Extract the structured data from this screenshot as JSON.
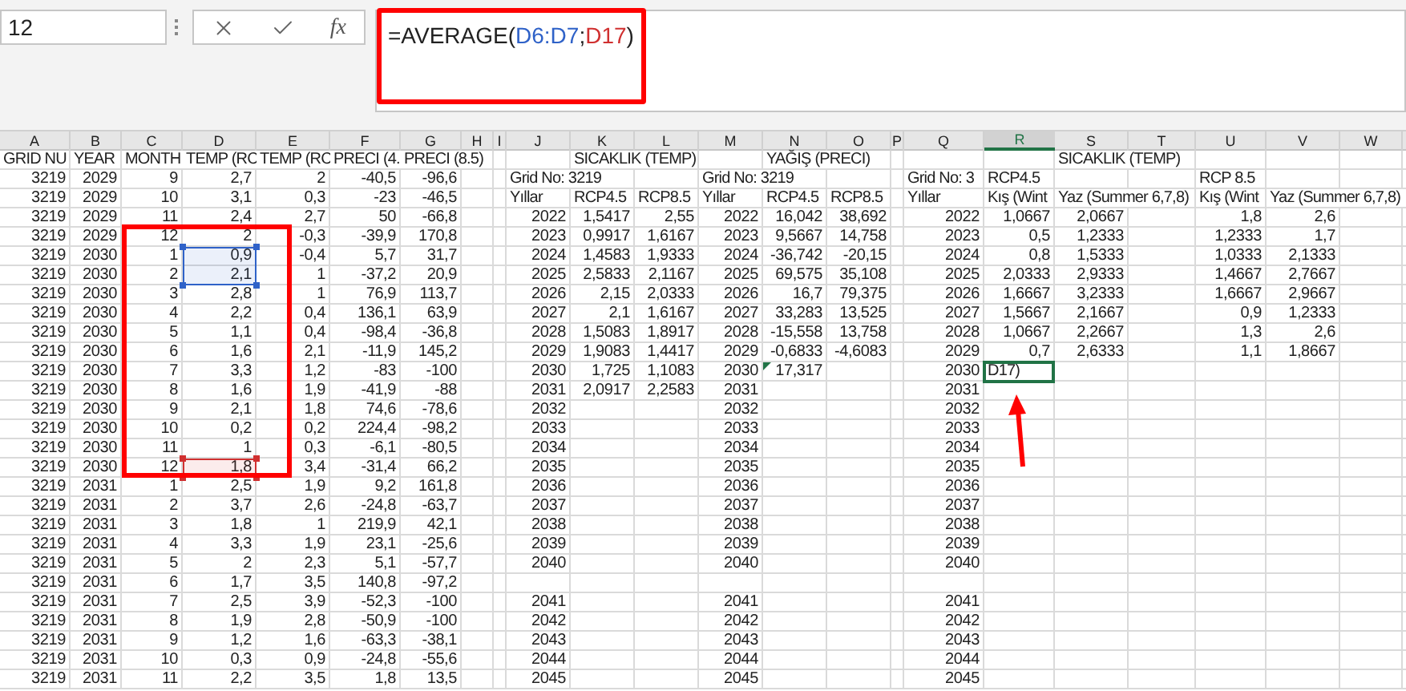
{
  "name_box": {
    "value": "12"
  },
  "formula_bar": {
    "function_label": "fx",
    "parts": [
      {
        "text": "=AVERAGE("
      },
      {
        "text": "D6:D7",
        "color": "#2f62c8"
      },
      {
        "text": ";"
      },
      {
        "text": "D17",
        "color": "#d03030"
      },
      {
        "text": ")"
      }
    ]
  },
  "columns": [
    {
      "letter": "A",
      "selected": false
    },
    {
      "letter": "B",
      "selected": false
    },
    {
      "letter": "C",
      "selected": false
    },
    {
      "letter": "D",
      "selected": false
    },
    {
      "letter": "E",
      "selected": false
    },
    {
      "letter": "F",
      "selected": false
    },
    {
      "letter": "G",
      "selected": false
    },
    {
      "letter": "H",
      "selected": false
    },
    {
      "letter": "I",
      "selected": false
    },
    {
      "letter": "J",
      "selected": false
    },
    {
      "letter": "K",
      "selected": false
    },
    {
      "letter": "L",
      "selected": false
    },
    {
      "letter": "M",
      "selected": false
    },
    {
      "letter": "N",
      "selected": false
    },
    {
      "letter": "O",
      "selected": false
    },
    {
      "letter": "P",
      "selected": false
    },
    {
      "letter": "Q",
      "selected": false
    },
    {
      "letter": "R",
      "selected": true
    },
    {
      "letter": "S",
      "selected": false
    },
    {
      "letter": "T",
      "selected": false
    },
    {
      "letter": "U",
      "selected": false
    },
    {
      "letter": "V",
      "selected": false
    },
    {
      "letter": "W",
      "selected": false
    }
  ],
  "rows": [
    {
      "labels": {
        "A": "GRID NU",
        "B": "YEAR",
        "C": "MONTH",
        "D": "TEMP (RC",
        "E": "TEMP (RC",
        "F": "PRECI (4.",
        "G": "PRECI (8.5)",
        "K": "SICAKLIK (TEMP)",
        "N": "YAĞIŞ (PRECI)",
        "S": "SICAKLIK (TEMP)"
      }
    },
    {
      "cells": {
        "A": "3219",
        "B": "2029",
        "C": "9",
        "D": "2,7",
        "E": "2",
        "F": "-40,5",
        "G": "-96,6"
      },
      "labels": {
        "J": "Grid No: 3219",
        "M": "Grid No: 3219",
        "Q": "Grid No: 3",
        "R": "RCP4.5",
        "U": "RCP 8.5"
      }
    },
    {
      "cells": {
        "A": "3219",
        "B": "2029",
        "C": "10",
        "D": "3,1",
        "E": "0,3",
        "F": "-23",
        "G": "-46,5"
      },
      "labels": {
        "J": "Yıllar",
        "K": "RCP4.5",
        "L": "RCP8.5",
        "M": "Yıllar",
        "N": "RCP4.5",
        "O": "RCP8.5",
        "Q": "Yıllar",
        "R": "Kış (Wint",
        "S": "Yaz (Summer 6,7,8)",
        "U": "Kış (Wint",
        "V": "Yaz (Summer 6,7,8)"
      }
    },
    {
      "cells": {
        "A": "3219",
        "B": "2029",
        "C": "11",
        "D": "2,4",
        "E": "2,7",
        "F": "50",
        "G": "-66,8",
        "J": "2022",
        "K": "1,5417",
        "L": "2,55",
        "M": "2022",
        "N": "16,042",
        "O": "38,692",
        "Q": "2022",
        "R": "1,0667",
        "S": "2,0667",
        "U": "1,8",
        "V": "2,6"
      }
    },
    {
      "cells": {
        "A": "3219",
        "B": "2029",
        "C": "12",
        "D": "2",
        "E": "-0,3",
        "F": "-39,9",
        "G": "170,8",
        "J": "2023",
        "K": "0,9917",
        "L": "1,6167",
        "M": "2023",
        "N": "9,5667",
        "O": "14,758",
        "Q": "2023",
        "R": "0,5",
        "S": "1,2333",
        "U": "1,2333",
        "V": "1,7"
      }
    },
    {
      "cells": {
        "A": "3219",
        "B": "2030",
        "C": "1",
        "D": "0,9",
        "E": "-0,4",
        "F": "5,7",
        "G": "31,7",
        "J": "2024",
        "K": "1,4583",
        "L": "1,9333",
        "M": "2024",
        "N": "-36,742",
        "O": "-20,15",
        "Q": "2024",
        "R": "0,8",
        "S": "1,5333",
        "U": "1,0333",
        "V": "2,1333"
      }
    },
    {
      "cells": {
        "A": "3219",
        "B": "2030",
        "C": "2",
        "D": "2,1",
        "E": "1",
        "F": "-37,2",
        "G": "20,9",
        "J": "2025",
        "K": "2,5833",
        "L": "2,1167",
        "M": "2025",
        "N": "69,575",
        "O": "35,108",
        "Q": "2025",
        "R": "2,0333",
        "S": "2,9333",
        "U": "1,4667",
        "V": "2,7667"
      }
    },
    {
      "cells": {
        "A": "3219",
        "B": "2030",
        "C": "3",
        "D": "2,8",
        "E": "1",
        "F": "76,9",
        "G": "113,7",
        "J": "2026",
        "K": "2,15",
        "L": "2,0333",
        "M": "2026",
        "N": "16,7",
        "O": "79,375",
        "Q": "2026",
        "R": "1,6667",
        "S": "3,2333",
        "U": "1,6667",
        "V": "2,9667"
      }
    },
    {
      "cells": {
        "A": "3219",
        "B": "2030",
        "C": "4",
        "D": "2,2",
        "E": "0,4",
        "F": "136,1",
        "G": "63,9",
        "J": "2027",
        "K": "2,1",
        "L": "1,6167",
        "M": "2027",
        "N": "33,283",
        "O": "13,525",
        "Q": "2027",
        "R": "1,5667",
        "S": "2,1667",
        "U": "0,9",
        "V": "1,2333"
      }
    },
    {
      "cells": {
        "A": "3219",
        "B": "2030",
        "C": "5",
        "D": "1,1",
        "E": "0,4",
        "F": "-98,4",
        "G": "-36,8",
        "J": "2028",
        "K": "1,5083",
        "L": "1,8917",
        "M": "2028",
        "N": "-15,558",
        "O": "13,758",
        "Q": "2028",
        "R": "1,0667",
        "S": "2,2667",
        "U": "1,3",
        "V": "2,6"
      }
    },
    {
      "cells": {
        "A": "3219",
        "B": "2030",
        "C": "6",
        "D": "1,6",
        "E": "2,1",
        "F": "-11,9",
        "G": "145,2",
        "J": "2029",
        "K": "1,9083",
        "L": "1,4417",
        "M": "2029",
        "N": "-0,6833",
        "O": "-4,6083",
        "Q": "2029",
        "R": "0,7",
        "S": "2,6333",
        "U": "1,1",
        "V": "1,8667"
      }
    },
    {
      "cells": {
        "A": "3219",
        "B": "2030",
        "C": "7",
        "D": "3,3",
        "E": "1,2",
        "F": "-83",
        "G": "-100",
        "J": "2030",
        "K": "1,725",
        "L": "1,1083",
        "M": "2030",
        "N": "17,317",
        "Q": "2030"
      },
      "labels": {
        "R": "D17)"
      },
      "active": {
        "R": true
      },
      "flagged": {
        "N": true
      }
    },
    {
      "cells": {
        "A": "3219",
        "B": "2030",
        "C": "8",
        "D": "1,6",
        "E": "1,9",
        "F": "-41,9",
        "G": "-88",
        "J": "2031",
        "K": "2,0917",
        "L": "2,2583",
        "M": "2031",
        "Q": "2031"
      }
    },
    {
      "cells": {
        "A": "3219",
        "B": "2030",
        "C": "9",
        "D": "2,1",
        "E": "1,8",
        "F": "74,6",
        "G": "-78,6",
        "J": "2032",
        "M": "2032",
        "Q": "2032"
      }
    },
    {
      "cells": {
        "A": "3219",
        "B": "2030",
        "C": "10",
        "D": "0,2",
        "E": "0,2",
        "F": "224,4",
        "G": "-98,2",
        "J": "2033",
        "M": "2033",
        "Q": "2033"
      }
    },
    {
      "cells": {
        "A": "3219",
        "B": "2030",
        "C": "11",
        "D": "1",
        "E": "0,3",
        "F": "-6,1",
        "G": "-80,5",
        "J": "2034",
        "M": "2034",
        "Q": "2034"
      }
    },
    {
      "cells": {
        "A": "3219",
        "B": "2030",
        "C": "12",
        "D": "1,8",
        "E": "3,4",
        "F": "-31,4",
        "G": "66,2",
        "J": "2035",
        "M": "2035",
        "Q": "2035"
      }
    },
    {
      "cells": {
        "A": "3219",
        "B": "2031",
        "C": "1",
        "D": "2,5",
        "E": "1,9",
        "F": "9,2",
        "G": "161,8",
        "J": "2036",
        "M": "2036",
        "Q": "2036"
      }
    },
    {
      "cells": {
        "A": "3219",
        "B": "2031",
        "C": "2",
        "D": "3,7",
        "E": "2,6",
        "F": "-24,8",
        "G": "-63,7",
        "J": "2037",
        "M": "2037",
        "Q": "2037"
      }
    },
    {
      "cells": {
        "A": "3219",
        "B": "2031",
        "C": "3",
        "D": "1,8",
        "E": "1",
        "F": "219,9",
        "G": "42,1",
        "J": "2038",
        "M": "2038",
        "Q": "2038"
      }
    },
    {
      "cells": {
        "A": "3219",
        "B": "2031",
        "C": "4",
        "D": "3,3",
        "E": "1,9",
        "F": "23,1",
        "G": "-25,6",
        "J": "2039",
        "M": "2039",
        "Q": "2039"
      }
    },
    {
      "cells": {
        "A": "3219",
        "B": "2031",
        "C": "5",
        "D": "2",
        "E": "2,3",
        "F": "5,1",
        "G": "-57,7",
        "J": "2040",
        "M": "2040",
        "Q": "2040"
      }
    },
    {
      "cells": {
        "A": "3219",
        "B": "2031",
        "C": "6",
        "D": "1,7",
        "E": "3,5",
        "F": "140,8",
        "G": "-97,2"
      }
    },
    {
      "cells": {
        "A": "3219",
        "B": "2031",
        "C": "7",
        "D": "2,5",
        "E": "3,9",
        "F": "-52,3",
        "G": "-100",
        "J": "2041",
        "M": "2041",
        "Q": "2041"
      }
    },
    {
      "cells": {
        "A": "3219",
        "B": "2031",
        "C": "8",
        "D": "1,9",
        "E": "2,8",
        "F": "-50,9",
        "G": "-100",
        "J": "2042",
        "M": "2042",
        "Q": "2042"
      }
    },
    {
      "cells": {
        "A": "3219",
        "B": "2031",
        "C": "9",
        "D": "1,2",
        "E": "1,6",
        "F": "-63,3",
        "G": "-38,1",
        "J": "2043",
        "M": "2043",
        "Q": "2043"
      }
    },
    {
      "cells": {
        "A": "3219",
        "B": "2031",
        "C": "10",
        "D": "0,3",
        "E": "0,9",
        "F": "-24,8",
        "G": "-55,6",
        "J": "2044",
        "M": "2044",
        "Q": "2044"
      }
    },
    {
      "cells": {
        "A": "3219",
        "B": "2031",
        "C": "11",
        "D": "2,2",
        "E": "3,5",
        "F": "1,8",
        "G": "13,5",
        "J": "2045",
        "M": "2045",
        "Q": "2045"
      }
    }
  ]
}
